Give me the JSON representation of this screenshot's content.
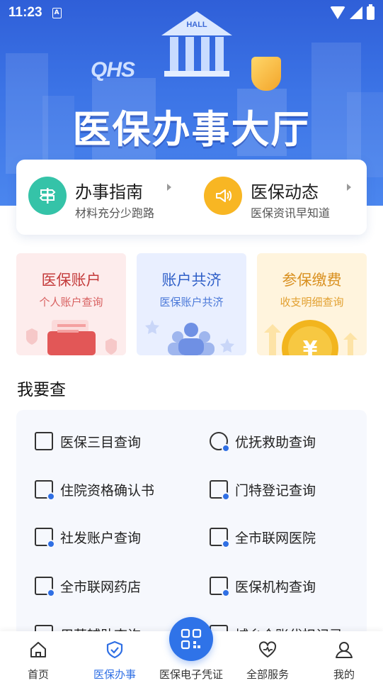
{
  "status_bar": {
    "time": "11:23",
    "notification_glyph": "A"
  },
  "hero": {
    "badge_text": "HALL",
    "logo_text": "QHS",
    "title": "医保办事大厅"
  },
  "quick_links": [
    {
      "title": "办事指南",
      "subtitle": "材料充分少跑路",
      "icon": "signpost-icon",
      "color": "#35c3a8"
    },
    {
      "title": "医保动态",
      "subtitle": "医保资讯早知道",
      "icon": "speaker-icon",
      "color": "#f8b623"
    }
  ],
  "feature_cards": [
    {
      "title": "医保账户",
      "subtitle": "个人账户查询",
      "title_color": "#c43b3b",
      "subtitle_color": "#d86060",
      "bg": "#fdecec"
    },
    {
      "title": "账户共济",
      "subtitle": "医保账户共济",
      "title_color": "#2f5fc8",
      "subtitle_color": "#4a78d8",
      "bg": "#e9efff"
    },
    {
      "title": "参保缴费",
      "subtitle": "收支明细查询",
      "title_color": "#d99020",
      "subtitle_color": "#e2a030",
      "bg": "#fff4dd"
    }
  ],
  "query_section": {
    "title": "我要查",
    "items": [
      {
        "label": "医保三目查询",
        "icon": "bookmark-doc-icon"
      },
      {
        "label": "优抚救助查询",
        "icon": "heart-hand-icon"
      },
      {
        "label": "住院资格确认书",
        "icon": "hospital-bed-icon"
      },
      {
        "label": "门特登记查询",
        "icon": "doc-person-icon"
      },
      {
        "label": "社发账户查询",
        "icon": "wallet-icon"
      },
      {
        "label": "全市联网医院",
        "icon": "hospital-network-icon"
      },
      {
        "label": "全市联网药店",
        "icon": "pharmacy-network-icon"
      },
      {
        "label": "医保机构查询",
        "icon": "institution-search-icon"
      },
      {
        "label": "用药辅助查询",
        "icon": "medicine-icon"
      },
      {
        "label": "城乡个账代扣记录",
        "icon": "doc-record-icon"
      }
    ]
  },
  "bottom_nav": [
    {
      "label": "首页",
      "icon": "home-icon",
      "active": false
    },
    {
      "label": "医保办事",
      "icon": "shield-check-icon",
      "active": true
    },
    {
      "label": "医保电子凭证",
      "icon": "qr-code-icon",
      "active": false
    },
    {
      "label": "全部服务",
      "icon": "heart-pulse-icon",
      "active": false
    },
    {
      "label": "我的",
      "icon": "user-icon",
      "active": false
    }
  ],
  "colors": {
    "accent": "#2f6fe4",
    "hero_blue": "#3c74e6"
  }
}
